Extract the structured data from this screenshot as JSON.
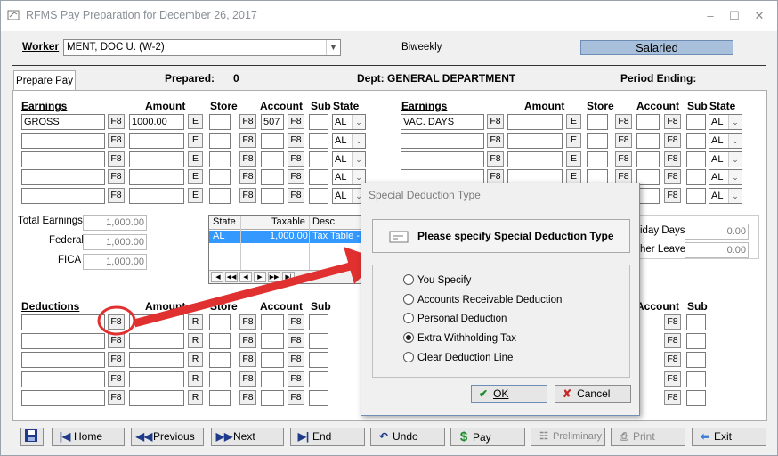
{
  "window": {
    "title": "RFMS Pay Preparation for December 26, 2017"
  },
  "worker": {
    "label": "Worker",
    "value": "MENT, DOC U. (W-2)",
    "frequency": "Biweekly",
    "type": "Salaried"
  },
  "tab": {
    "label": "Prepare Pay"
  },
  "header": {
    "prepared_label": "Prepared:",
    "prepared_value": "0",
    "dept": "Dept: GENERAL DEPARTMENT",
    "period_ending": "Period Ending:"
  },
  "earnings_cols": {
    "earnings": "Earnings",
    "amount": "Amount",
    "store": "Store",
    "account": "Account",
    "sub": "Sub",
    "state": "State"
  },
  "earnings_left": [
    {
      "earnings": "GROSS",
      "amount": "1000.00",
      "account": "507",
      "state": "AL"
    },
    {
      "earnings": "",
      "amount": "",
      "account": "",
      "state": "AL"
    },
    {
      "earnings": "",
      "amount": "",
      "account": "",
      "state": "AL"
    },
    {
      "earnings": "",
      "amount": "",
      "account": "",
      "state": "AL"
    },
    {
      "earnings": "",
      "amount": "",
      "account": "",
      "state": "AL"
    }
  ],
  "earnings_right": [
    {
      "earnings": "VAC. DAYS",
      "state": "AL"
    },
    {
      "earnings": "",
      "state": "AL"
    },
    {
      "earnings": "",
      "state": "AL"
    },
    {
      "earnings": "",
      "state": "AL"
    },
    {
      "earnings": "",
      "state": "AL"
    }
  ],
  "buttons_small": {
    "f8": "F8",
    "e": "E",
    "r": "R"
  },
  "totals": {
    "total_earnings_label": "Total Earnings",
    "total_earnings": "1,000.00",
    "federal_label": "Federal",
    "federal": "1,000.00",
    "fica_label": "FICA",
    "fica": "1,000.00"
  },
  "tax_grid": {
    "cols": [
      "State",
      "Taxable",
      "Desc"
    ],
    "rows": [
      {
        "state": "AL",
        "taxable": "1,000.00",
        "desc": "Tax Table -"
      }
    ]
  },
  "right_totals": {
    "holiday_label": "iday Days",
    "holiday": "0.00",
    "other_label": "her Leave",
    "other": "0.00"
  },
  "deductions_cols": {
    "deductions": "Deductions",
    "amount": "Amount",
    "store": "Store",
    "account": "Account",
    "sub": "Sub"
  },
  "bottom_buttons": {
    "home": "Home",
    "previous": "Previous",
    "next": "Next",
    "end": "End",
    "undo": "Undo",
    "pay": "Pay",
    "preliminary": "Preliminary",
    "print": "Print",
    "exit": "Exit"
  },
  "dialog": {
    "title": "Special Deduction Type",
    "heading": "Please specify Special Deduction Type",
    "options": [
      "You Specify",
      "Accounts Receivable Deduction",
      "Personal Deduction",
      "Extra Withholding Tax",
      "Clear Deduction Line"
    ],
    "selected_index": 3,
    "ok": "OK",
    "cancel": "Cancel"
  },
  "colors": {
    "accent": "#a9c0dc",
    "arrow": "#e03030",
    "dialog_border": "#6f8fb5"
  }
}
